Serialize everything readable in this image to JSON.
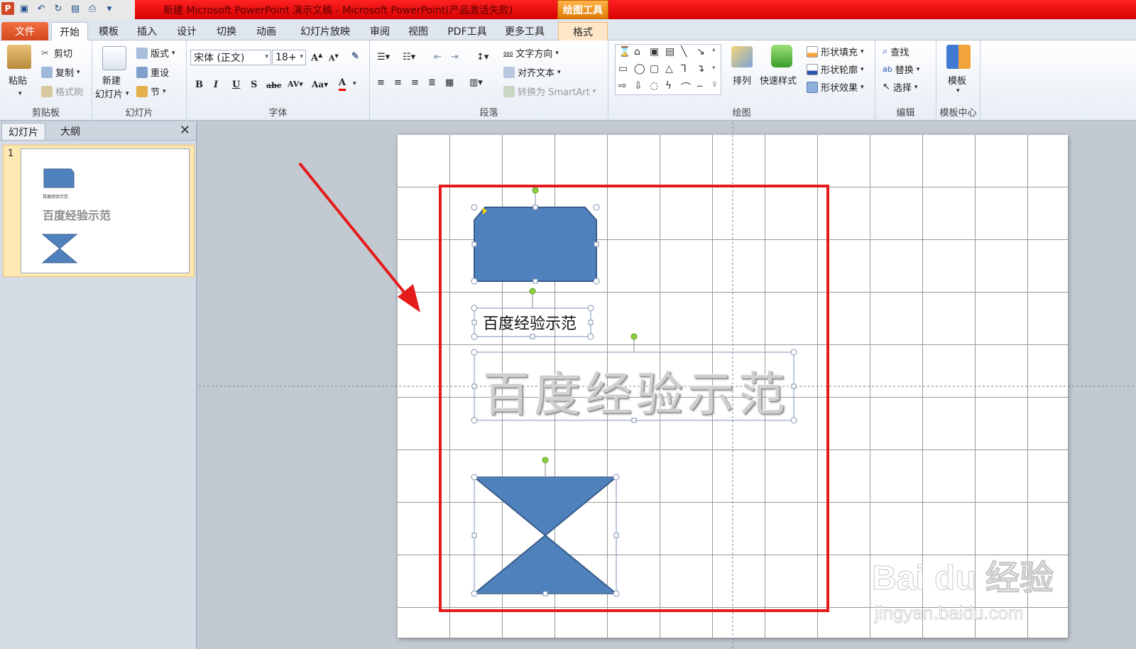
{
  "title_bar": {
    "title": "新建 Microsoft PowerPoint 演示文稿 - Microsoft PowerPoint(产品激活失败)",
    "context_tab": "绘图工具"
  },
  "tabs": [
    "文件",
    "开始",
    "模板",
    "插入",
    "设计",
    "切换",
    "动画",
    "幻灯片放映",
    "审阅",
    "视图",
    "PDF工具",
    "更多工具",
    "格式"
  ],
  "ribbon": {
    "clipboard": {
      "paste": "粘贴",
      "cut": "剪切",
      "copy": "复制",
      "format_painter": "格式刷",
      "label": "剪贴板"
    },
    "slides": {
      "new_slide_1": "新建",
      "new_slide_2": "幻灯片",
      "layout": "版式",
      "reset": "重设",
      "section": "节",
      "label": "幻灯片"
    },
    "font": {
      "font_name": "宋体 (正文)",
      "font_size": "18+",
      "label": "字体"
    },
    "paragraph": {
      "text_direction": "文字方向",
      "align_text": "对齐文本",
      "smartart": "转换为 SmartArt",
      "label": "段落"
    },
    "drawing": {
      "arrange": "排列",
      "quick_styles": "快速样式",
      "shape_fill": "形状填充",
      "shape_outline": "形状轮廓",
      "shape_effects": "形状效果",
      "label": "绘图"
    },
    "editing": {
      "find": "查找",
      "replace": "替换",
      "select": "选择",
      "label": "编辑"
    },
    "template_center": {
      "template": "模板",
      "label": "模板中心"
    }
  },
  "left_pane": {
    "tab_slides": "幻灯片",
    "tab_outline": "大纲",
    "slide_number": "1",
    "thumb_small_text": "百度经验示范",
    "thumb_big_text": "百度经验示范"
  },
  "slide": {
    "small_text": "百度经验示范",
    "big_text": "百度经验示范",
    "watermark_logo": "Bai du 经验",
    "watermark_url": "jingyan.baidu.com"
  },
  "colors": {
    "shape_fill": "#4f81bd",
    "shape_stroke": "#385d8a",
    "annotation": "#e51b1b"
  }
}
